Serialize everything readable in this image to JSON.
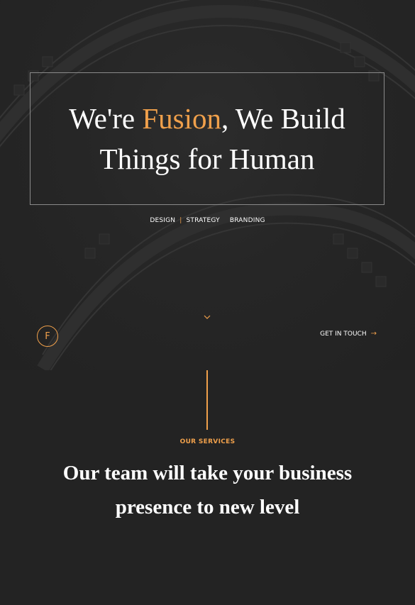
{
  "hero": {
    "headline_prefix": "We're ",
    "headline_accent": "Fusion",
    "headline_suffix": ", We Build Things for Human",
    "tagline": {
      "items": [
        "DESIGN",
        "STRATEGY",
        "BRANDING"
      ],
      "separator": "|"
    },
    "scroll_icon": "chevron-down-icon",
    "logo_letter": "F",
    "cta_label": "GET IN TOUCH",
    "cta_icon": "arrow-right-icon"
  },
  "services": {
    "label": "OUR SERVICES",
    "title": "Our team will take your business presence to new level"
  },
  "colors": {
    "accent": "#f0a04b",
    "background": "#232323",
    "text": "#ffffff"
  }
}
